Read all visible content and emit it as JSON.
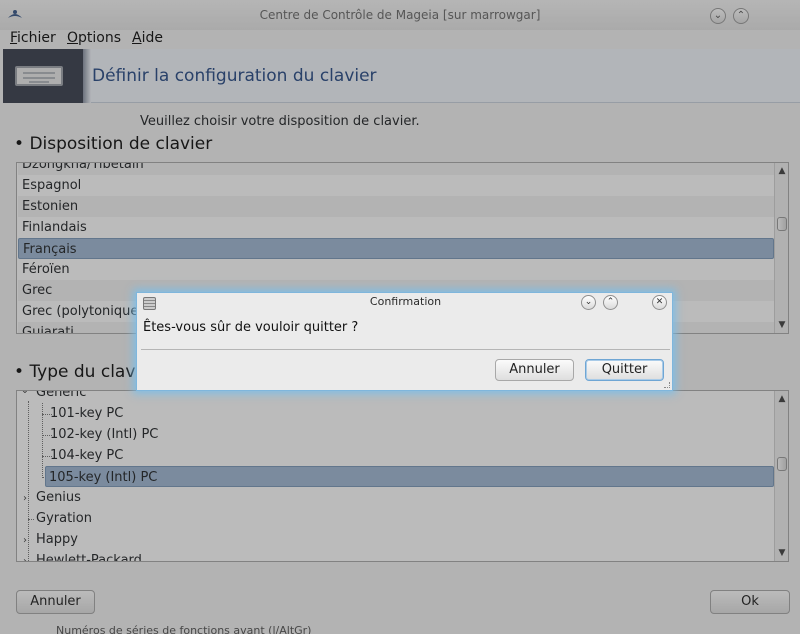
{
  "window": {
    "title": "Centre de Contrôle de Mageia  [sur marrowgar]",
    "menu": [
      "Fichier",
      "Options",
      "Aide"
    ],
    "menu_mnemonics": [
      "F",
      "O",
      "A"
    ]
  },
  "banner": {
    "title": "Définir la configuration du clavier"
  },
  "prompt": "Veuillez choisir votre disposition de clavier.",
  "layout_section": {
    "heading": "Disposition de clavier",
    "items": [
      "Dzongkha/Tibétain",
      "Espagnol",
      "Estonien",
      "Finlandais",
      "Français",
      "Féroïen",
      "Grec",
      "Grec (polytonique)",
      "Gujarati"
    ],
    "selected": "Français"
  },
  "type_section": {
    "heading": "Type du clavier",
    "heading_visible": "Type du clav",
    "tree": [
      {
        "label": "Generic",
        "level": 0,
        "expanded": true
      },
      {
        "label": "101-key PC",
        "level": 1
      },
      {
        "label": "102-key (Intl) PC",
        "level": 1
      },
      {
        "label": "104-key PC",
        "level": 1
      },
      {
        "label": "105-key (Intl) PC",
        "level": 1,
        "selected": true
      },
      {
        "label": "Genius",
        "level": 0,
        "expanded": false
      },
      {
        "label": "Gyration",
        "level": 0
      },
      {
        "label": "Happy",
        "level": 0,
        "expanded": false
      },
      {
        "label": "Hewlett-Packard",
        "level": 0,
        "expanded": false
      }
    ]
  },
  "footer": {
    "cancel": "Annuler",
    "ok": "Ok"
  },
  "stray_text": "Numéros de séries de fonctions avant (l/AltGr)",
  "dialog": {
    "title": "Confirmation",
    "message": "Êtes-vous sûr de vouloir quitter ?",
    "cancel": "Annuler",
    "quit": "Quitter"
  },
  "colors": {
    "selection": "#9fb7d1",
    "banner_title": "#2a4c86",
    "dialog_glow": "#7fb6dc"
  }
}
